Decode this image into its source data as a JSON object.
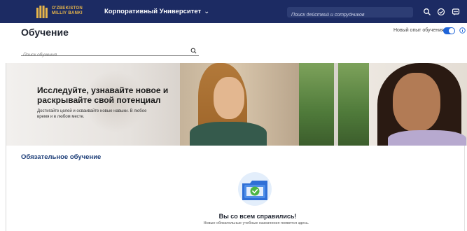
{
  "topbar": {
    "logo_line1": "O'ZBEKISTON",
    "logo_line2": "MILLIY BANKI",
    "university_label": "Корпоративный Университет",
    "search_placeholder": "Поиск действий и сотрудников",
    "icons": [
      "search-icon",
      "help-icon",
      "notifications-icon"
    ]
  },
  "header": {
    "title": "Обучение",
    "new_experience_label": "Новый опыт обучения",
    "toggle_on": true
  },
  "learning_search": {
    "placeholder": "Поиск обучения"
  },
  "banner": {
    "heading": "Исследуйте, узнавайте новое и раскрывайте свой потенциал",
    "subtext": "Достигайте целей и осваивайте новые навыки. В любое время и в любом месте."
  },
  "required": {
    "section_title": "Обязательное обучение",
    "done_title": "Вы со всем справились!",
    "done_subtext": "Новые обязательные учебные назначения появятся здесь."
  },
  "colors": {
    "topbar": "#1c2b63",
    "logo_gold": "#e8b64a",
    "accent_blue": "#1f64d8",
    "section_title": "#1d3e78",
    "check_green": "#4bb543"
  }
}
